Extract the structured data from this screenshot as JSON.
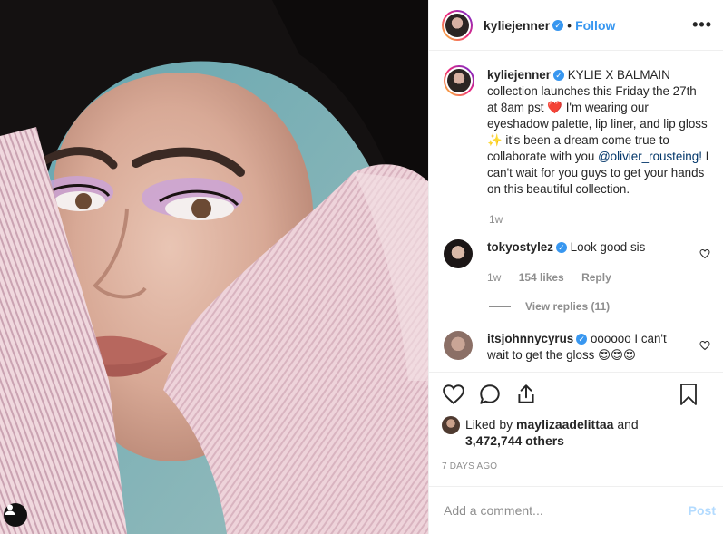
{
  "header": {
    "username": "kyliejenner",
    "separator": "•",
    "follow_label": "Follow",
    "more_icon": "•••"
  },
  "caption": {
    "username": "kyliejenner",
    "text_1": "KYLIE X BALMAIN collection launches this Friday the 27th at 8am pst",
    "emoji_1": "❤️",
    "text_2": "I'm wearing our eyeshadow palette, lip liner, and lip gloss",
    "emoji_2": "✨",
    "text_3": "it's been a dream come true to collaborate with you",
    "mention": "@olivier_rousteing!",
    "text_4": "I can't wait for you guys to get your hands on this beautiful collection.",
    "time": "1w"
  },
  "comments": [
    {
      "username": "tokyostylez",
      "text": "Look good sis",
      "time": "1w",
      "likes": "154 likes",
      "reply_label": "Reply",
      "view_replies": "View replies (11)"
    },
    {
      "username": "itsjohnnycyrus",
      "text": "oooooo I can't wait to get the gloss",
      "emoji": "😍😍😍"
    }
  ],
  "likes": {
    "prefix": "Liked by",
    "user": "maylizaadelittaa",
    "and": "and",
    "others": "3,472,744 others"
  },
  "date": "7 DAYS AGO",
  "add_comment": {
    "placeholder": "Add a comment...",
    "post_label": "Post"
  },
  "colors": {
    "accent": "#3897f0",
    "text": "#262626",
    "muted": "#8e8e8e",
    "border": "#efefef"
  },
  "icons": {
    "like": "heart-icon",
    "comment": "comment-icon",
    "share": "share-icon",
    "save": "bookmark-icon",
    "tag": "user-tag-icon",
    "verified": "verified-badge-icon"
  }
}
